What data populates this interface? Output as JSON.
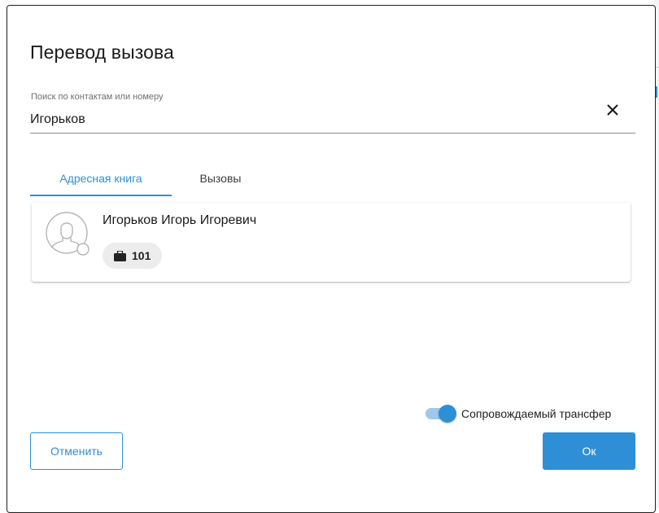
{
  "dialog": {
    "title": "Перевод вызова"
  },
  "search": {
    "label": "Поиск по контактам или номеру",
    "value": "Игорьков",
    "clear_icon": "close-icon"
  },
  "tabs": [
    {
      "label": "Адресная книга",
      "active": true
    },
    {
      "label": "Вызовы",
      "active": false
    }
  ],
  "contacts": [
    {
      "name": "Игорьков Игорь Игоревич",
      "avatar_icon": "user-avatar-icon",
      "phone_icon": "briefcase-icon",
      "extension": "101"
    }
  ],
  "toggle": {
    "label": "Сопровождаемый трансфер",
    "on": true
  },
  "actions": {
    "cancel_label": "Отменить",
    "ok_label": "Ок"
  },
  "colors": {
    "accent": "#2f8fd6",
    "chip_bg": "#ececec"
  }
}
